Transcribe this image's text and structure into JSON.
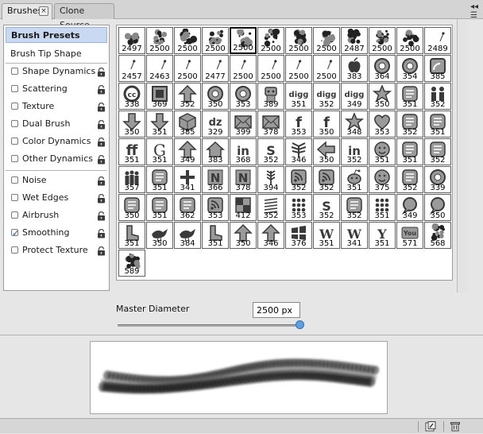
{
  "tabs": [
    {
      "label": "Brushes",
      "active": true
    },
    {
      "label": "Clone Source",
      "active": false
    }
  ],
  "panel_menu_icon": "panel-menu-icon",
  "left_panel": {
    "header_items": [
      "Brush Presets",
      "Brush Tip Shape"
    ],
    "selected": "Brush Presets",
    "group1": [
      {
        "label": "Shape Dynamics",
        "checked": false
      },
      {
        "label": "Scattering",
        "checked": false
      },
      {
        "label": "Texture",
        "checked": false
      },
      {
        "label": "Dual Brush",
        "checked": false
      },
      {
        "label": "Color Dynamics",
        "checked": false
      },
      {
        "label": "Other Dynamics",
        "checked": false
      }
    ],
    "group2": [
      {
        "label": "Noise",
        "checked": false
      },
      {
        "label": "Wet Edges",
        "checked": false
      },
      {
        "label": "Airbrush",
        "checked": false
      },
      {
        "label": "Smoothing",
        "checked": true
      },
      {
        "label": "Protect Texture",
        "checked": false
      }
    ],
    "lock_icon": "lock-icon"
  },
  "brush_grid": {
    "selected_index": 4,
    "sizes": [
      2497,
      2500,
      2500,
      2500,
      2500,
      2500,
      2500,
      2500,
      2487,
      2500,
      2500,
      2489,
      2457,
      2463,
      2500,
      2477,
      2500,
      2500,
      2500,
      2500,
      383,
      364,
      354,
      385,
      338,
      369,
      352,
      350,
      353,
      389,
      351,
      352,
      349,
      350,
      351,
      352,
      350,
      351,
      385,
      329,
      399,
      378,
      353,
      350,
      348,
      353,
      352,
      351,
      351,
      351,
      349,
      383,
      368,
      352,
      346,
      350,
      352,
      351,
      351,
      352,
      357,
      351,
      341,
      366,
      378,
      394,
      352,
      352,
      351,
      375,
      352,
      339,
      350,
      351,
      362,
      353,
      412,
      352,
      353,
      352,
      352,
      351,
      349,
      350,
      351,
      350,
      384,
      351,
      350,
      346,
      376,
      351,
      341,
      351,
      571,
      568,
      589
    ],
    "glyphs": [
      "splatter",
      "splatter",
      "splatter",
      "splatter",
      "splatter",
      "splatter",
      "splatter",
      "splatter",
      "splatter",
      "splatter",
      "splatter",
      "dot",
      "dot",
      "dot",
      "dot",
      "dot",
      "dot",
      "dot",
      "dot",
      "dot",
      "apple",
      "circle",
      "circle",
      "badge",
      "cc",
      "square",
      "arrow-up",
      "circle",
      "circle",
      "robot",
      "digg",
      "digg",
      "digg",
      "star",
      "tile",
      "people",
      "arrow-down",
      "arrow-down",
      "cube",
      "dz",
      "envelope",
      "envelope",
      "f",
      "f",
      "star",
      "heart",
      "tile",
      "tile",
      "hashtag",
      "g",
      "arrow-up",
      "home",
      "in",
      "s",
      "fountain",
      "arrow-left",
      "in",
      "smile",
      "tile",
      "tile",
      "group",
      "tile",
      "plus",
      "N",
      "N",
      "wheat",
      "rss",
      "rss",
      "reddit",
      "smile",
      "tile",
      "circle",
      "tile",
      "tile",
      "tile",
      "rss",
      "box",
      "lines",
      "dots",
      "s",
      "tile",
      "dots",
      "bubble",
      "bubble",
      "boot",
      "bird",
      "bird",
      "boot",
      "arrow-up",
      "arrow-up",
      "windows",
      "W",
      "W",
      "Y",
      "you",
      "splatter",
      "splatter",
      "splatter"
    ]
  },
  "master_diameter": {
    "label": "Master Diameter",
    "value": "2500 px",
    "slider_fraction": 1.0
  },
  "bottom_bar": {
    "icons": [
      "new-brush-icon",
      "trash-icon"
    ]
  }
}
